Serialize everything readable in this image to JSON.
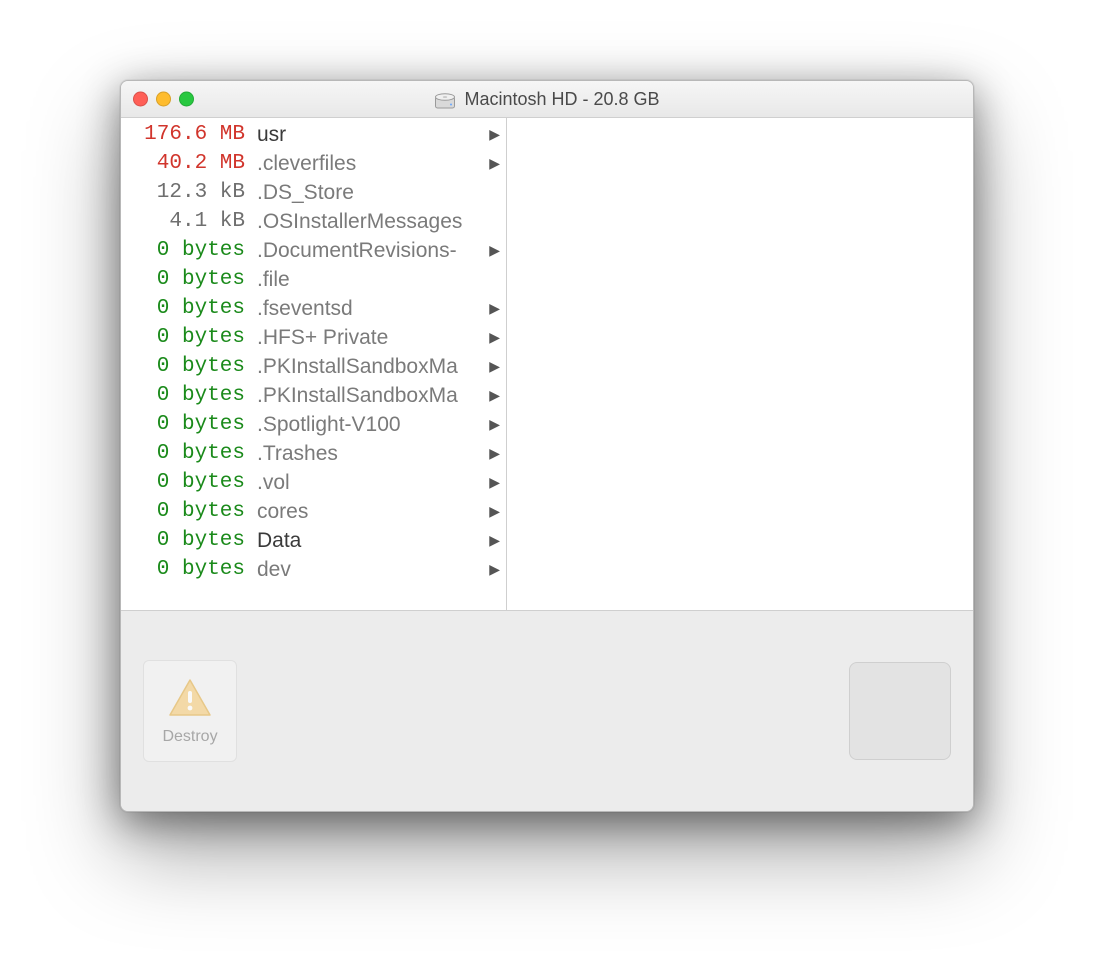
{
  "window": {
    "title": "Macintosh HD - 20.8 GB"
  },
  "files": [
    {
      "size": "176.6 MB",
      "sizeClass": "red",
      "name": "usr",
      "nameClass": "",
      "expandable": true
    },
    {
      "size": "40.2 MB",
      "sizeClass": "red",
      "name": ".cleverfiles",
      "nameClass": "dim",
      "expandable": true
    },
    {
      "size": "12.3 kB",
      "sizeClass": "gray",
      "name": ".DS_Store",
      "nameClass": "dim",
      "expandable": false
    },
    {
      "size": "4.1 kB",
      "sizeClass": "gray",
      "name": ".OSInstallerMessages",
      "nameClass": "dim",
      "expandable": false
    },
    {
      "size": "0 bytes",
      "sizeClass": "green",
      "name": ".DocumentRevisions-",
      "nameClass": "dim",
      "expandable": true
    },
    {
      "size": "0 bytes",
      "sizeClass": "green",
      "name": ".file",
      "nameClass": "dim",
      "expandable": false
    },
    {
      "size": "0 bytes",
      "sizeClass": "green",
      "name": ".fseventsd",
      "nameClass": "dim",
      "expandable": true
    },
    {
      "size": "0 bytes",
      "sizeClass": "green",
      "name": ".HFS+ Private",
      "nameClass": "dim",
      "expandable": true
    },
    {
      "size": "0 bytes",
      "sizeClass": "green",
      "name": ".PKInstallSandboxMa",
      "nameClass": "dim",
      "expandable": true
    },
    {
      "size": "0 bytes",
      "sizeClass": "green",
      "name": ".PKInstallSandboxMa",
      "nameClass": "dim",
      "expandable": true
    },
    {
      "size": "0 bytes",
      "sizeClass": "green",
      "name": ".Spotlight-V100",
      "nameClass": "dim",
      "expandable": true
    },
    {
      "size": "0 bytes",
      "sizeClass": "green",
      "name": ".Trashes",
      "nameClass": "dim",
      "expandable": true
    },
    {
      "size": "0 bytes",
      "sizeClass": "green",
      "name": ".vol",
      "nameClass": "dim",
      "expandable": true
    },
    {
      "size": "0 bytes",
      "sizeClass": "green",
      "name": "cores",
      "nameClass": "dim",
      "expandable": true
    },
    {
      "size": "0 bytes",
      "sizeClass": "green",
      "name": "Data",
      "nameClass": "",
      "expandable": true
    },
    {
      "size": "0 bytes",
      "sizeClass": "green",
      "name": "dev",
      "nameClass": "dim",
      "expandable": true
    }
  ],
  "footer": {
    "destroy_label": "Destroy"
  },
  "glyphs": {
    "arrow": "▶"
  }
}
